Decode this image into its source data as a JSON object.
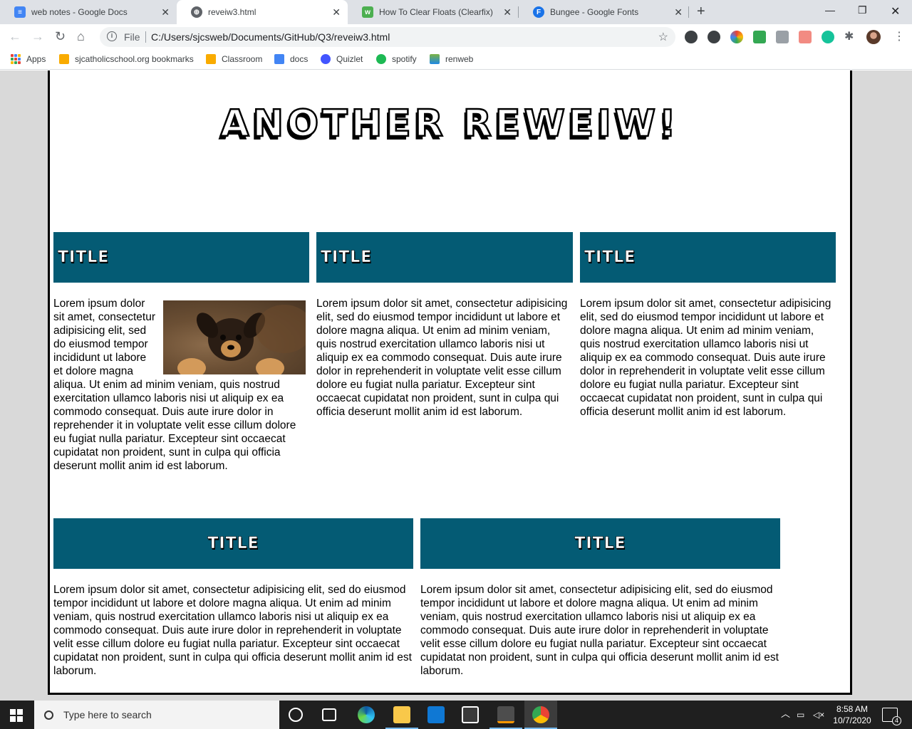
{
  "browser": {
    "tabs": [
      {
        "title": "web notes - Google Docs",
        "favicon": "docs-icon",
        "favicon_color": "#4285f4",
        "active": false
      },
      {
        "title": "reveiw3.html",
        "favicon": "globe-icon",
        "favicon_color": "#5f6368",
        "active": true
      },
      {
        "title": "How To Clear Floats (Clearfix)",
        "favicon": "w3schools-icon",
        "favicon_color": "#4caf50",
        "active": false
      },
      {
        "title": "Bungee - Google Fonts",
        "favicon": "google-fonts-icon",
        "favicon_color": "#1a73e8",
        "active": false
      }
    ],
    "address": {
      "scheme_label": "File",
      "url": "C:/Users/sjcsweb/Documents/GitHub/Q3/reveiw3.html"
    },
    "bookmarks": [
      "Apps",
      "sjcatholicschool.org bookmarks",
      "Classroom",
      "docs",
      "Quizlet",
      "spotify",
      "renweb"
    ]
  },
  "page": {
    "title": "ANOTHER REWEIW!",
    "heading_color": "#045b74",
    "cards_top": [
      {
        "title": "TITLE",
        "text": "Lorem ipsum dolor sit amet, consectetur adipisicing elit, sed do eiusmod tempor incididunt ut labore et dolore magna aliqua. Ut enim ad minim veniam, quis nostrud exercitation ullamco laboris nisi ut aliquip ex ea commodo consequat. Duis aute irure dolor in reprehender it in voluptate velit esse cillum dolore eu fugiat nulla pariatur. Excepteur sint occaecat cupidatat non proident, sunt in culpa qui officia deserunt mollit anim id est laborum."
      },
      {
        "title": "TITLE",
        "text": "Lorem ipsum dolor sit amet, consectetur adipisicing elit, sed do eiusmod tempor incididunt ut labore et dolore magna aliqua. Ut enim ad minim veniam, quis nostrud exercitation ullamco laboris nisi ut aliquip ex ea commodo consequat. Duis aute irure dolor in reprehenderit in voluptate velit esse cillum dolore eu fugiat nulla pariatur. Excepteur sint occaecat cupidatat non proident, sunt in culpa qui officia deserunt mollit anim id est laborum."
      },
      {
        "title": "TITLE",
        "text": "Lorem ipsum dolor sit amet, consectetur adipisicing elit, sed do eiusmod tempor incididunt ut labore et dolore magna aliqua. Ut enim ad minim veniam, quis nostrud exercitation ullamco laboris nisi ut aliquip ex ea commodo consequat. Duis aute irure dolor in reprehenderit in voluptate velit esse cillum dolore eu fugiat nulla pariatur. Excepteur sint occaecat cupidatat non proident, sunt in culpa qui officia deserunt mollit anim id est laborum."
      }
    ],
    "cards_bottom": [
      {
        "title": "TITLE",
        "text": "Lorem ipsum dolor sit amet, consectetur adipisicing elit, sed do eiusmod tempor incididunt ut labore et dolore magna aliqua. Ut enim ad minim veniam, quis nostrud exercitation ullamco laboris nisi ut aliquip ex ea commodo consequat. Duis aute irure dolor in reprehenderit in voluptate velit esse cillum dolore eu fugiat nulla pariatur. Excepteur sint occaecat cupidatat non proident, sunt in culpa qui officia deserunt mollit anim id est laborum."
      },
      {
        "title": "TITLE",
        "text": "Lorem ipsum dolor sit amet, consectetur adipisicing elit, sed do eiusmod tempor incididunt ut labore et dolore magna aliqua. Ut enim ad minim veniam, quis nostrud exercitation ullamco laboris nisi ut aliquip ex ea commodo consequat. Duis aute irure dolor in reprehenderit in voluptate velit esse cillum dolore eu fugiat nulla pariatur. Excepteur sint occaecat cupidatat non proident, sunt in culpa qui officia deserunt mollit anim id est laborum."
      }
    ],
    "image": {
      "subject": "puppy-photo"
    }
  },
  "taskbar": {
    "search_placeholder": "Type here to search",
    "time": "8:58 AM",
    "date": "10/7/2020",
    "notification_count": "4"
  }
}
